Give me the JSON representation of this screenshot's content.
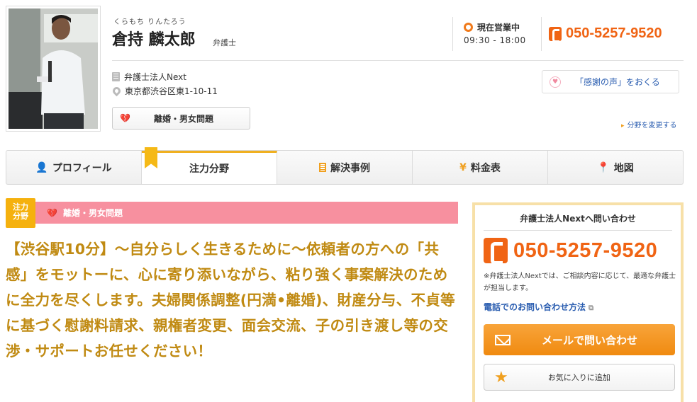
{
  "profile": {
    "ruby": "くらもち りんたろう",
    "name": "倉持 麟太郎",
    "title": "弁護士",
    "status": "現在営業中",
    "hours": "09:30 - 18:00",
    "phone": "050-5257-9520",
    "firm": "弁護士法人Next",
    "address": "東京都渋谷区東1-10-11",
    "category_button": "離婚・男女問題",
    "thanks_button": "「感謝の声」をおくる",
    "change_link": "分野を変更する"
  },
  "tabs": [
    {
      "label": "プロフィール"
    },
    {
      "label": "注力分野"
    },
    {
      "label": "解決事例"
    },
    {
      "label": "料金表"
    },
    {
      "label": "地図"
    }
  ],
  "focus": {
    "badge_line1": "注力",
    "badge_line2": "分野",
    "category": "離婚・男女問題",
    "catchcopy": "【渋谷駅10分】〜自分らしく生きるために〜依頼者の方への「共感」をモットーに、心に寄り添いながら、粘り強く事案解決のために全力を尽くします。夫婦関係調整(円満•離婚)、財産分与、不貞等に基づく慰謝料請求、親権者変更、面会交流、子の引き渡し等の交渉・サポートお任せください！"
  },
  "contact": {
    "heading": "弁護士法人Nextへ問い合わせ",
    "phone": "050-5257-9520",
    "note": "※弁護士法人Nextでは、ご相談内容に応じて、最適な弁護士が担当します。",
    "phone_link": "電話でのお問い合わせ方法",
    "mail_button": "メールで問い合わせ",
    "favorite_button": "お気に入りに追加"
  },
  "colors": {
    "accent_orange": "#f06414",
    "focus_pink": "#f7909f",
    "catch_gold": "#c08a12",
    "tab_gold": "#f0b020"
  }
}
